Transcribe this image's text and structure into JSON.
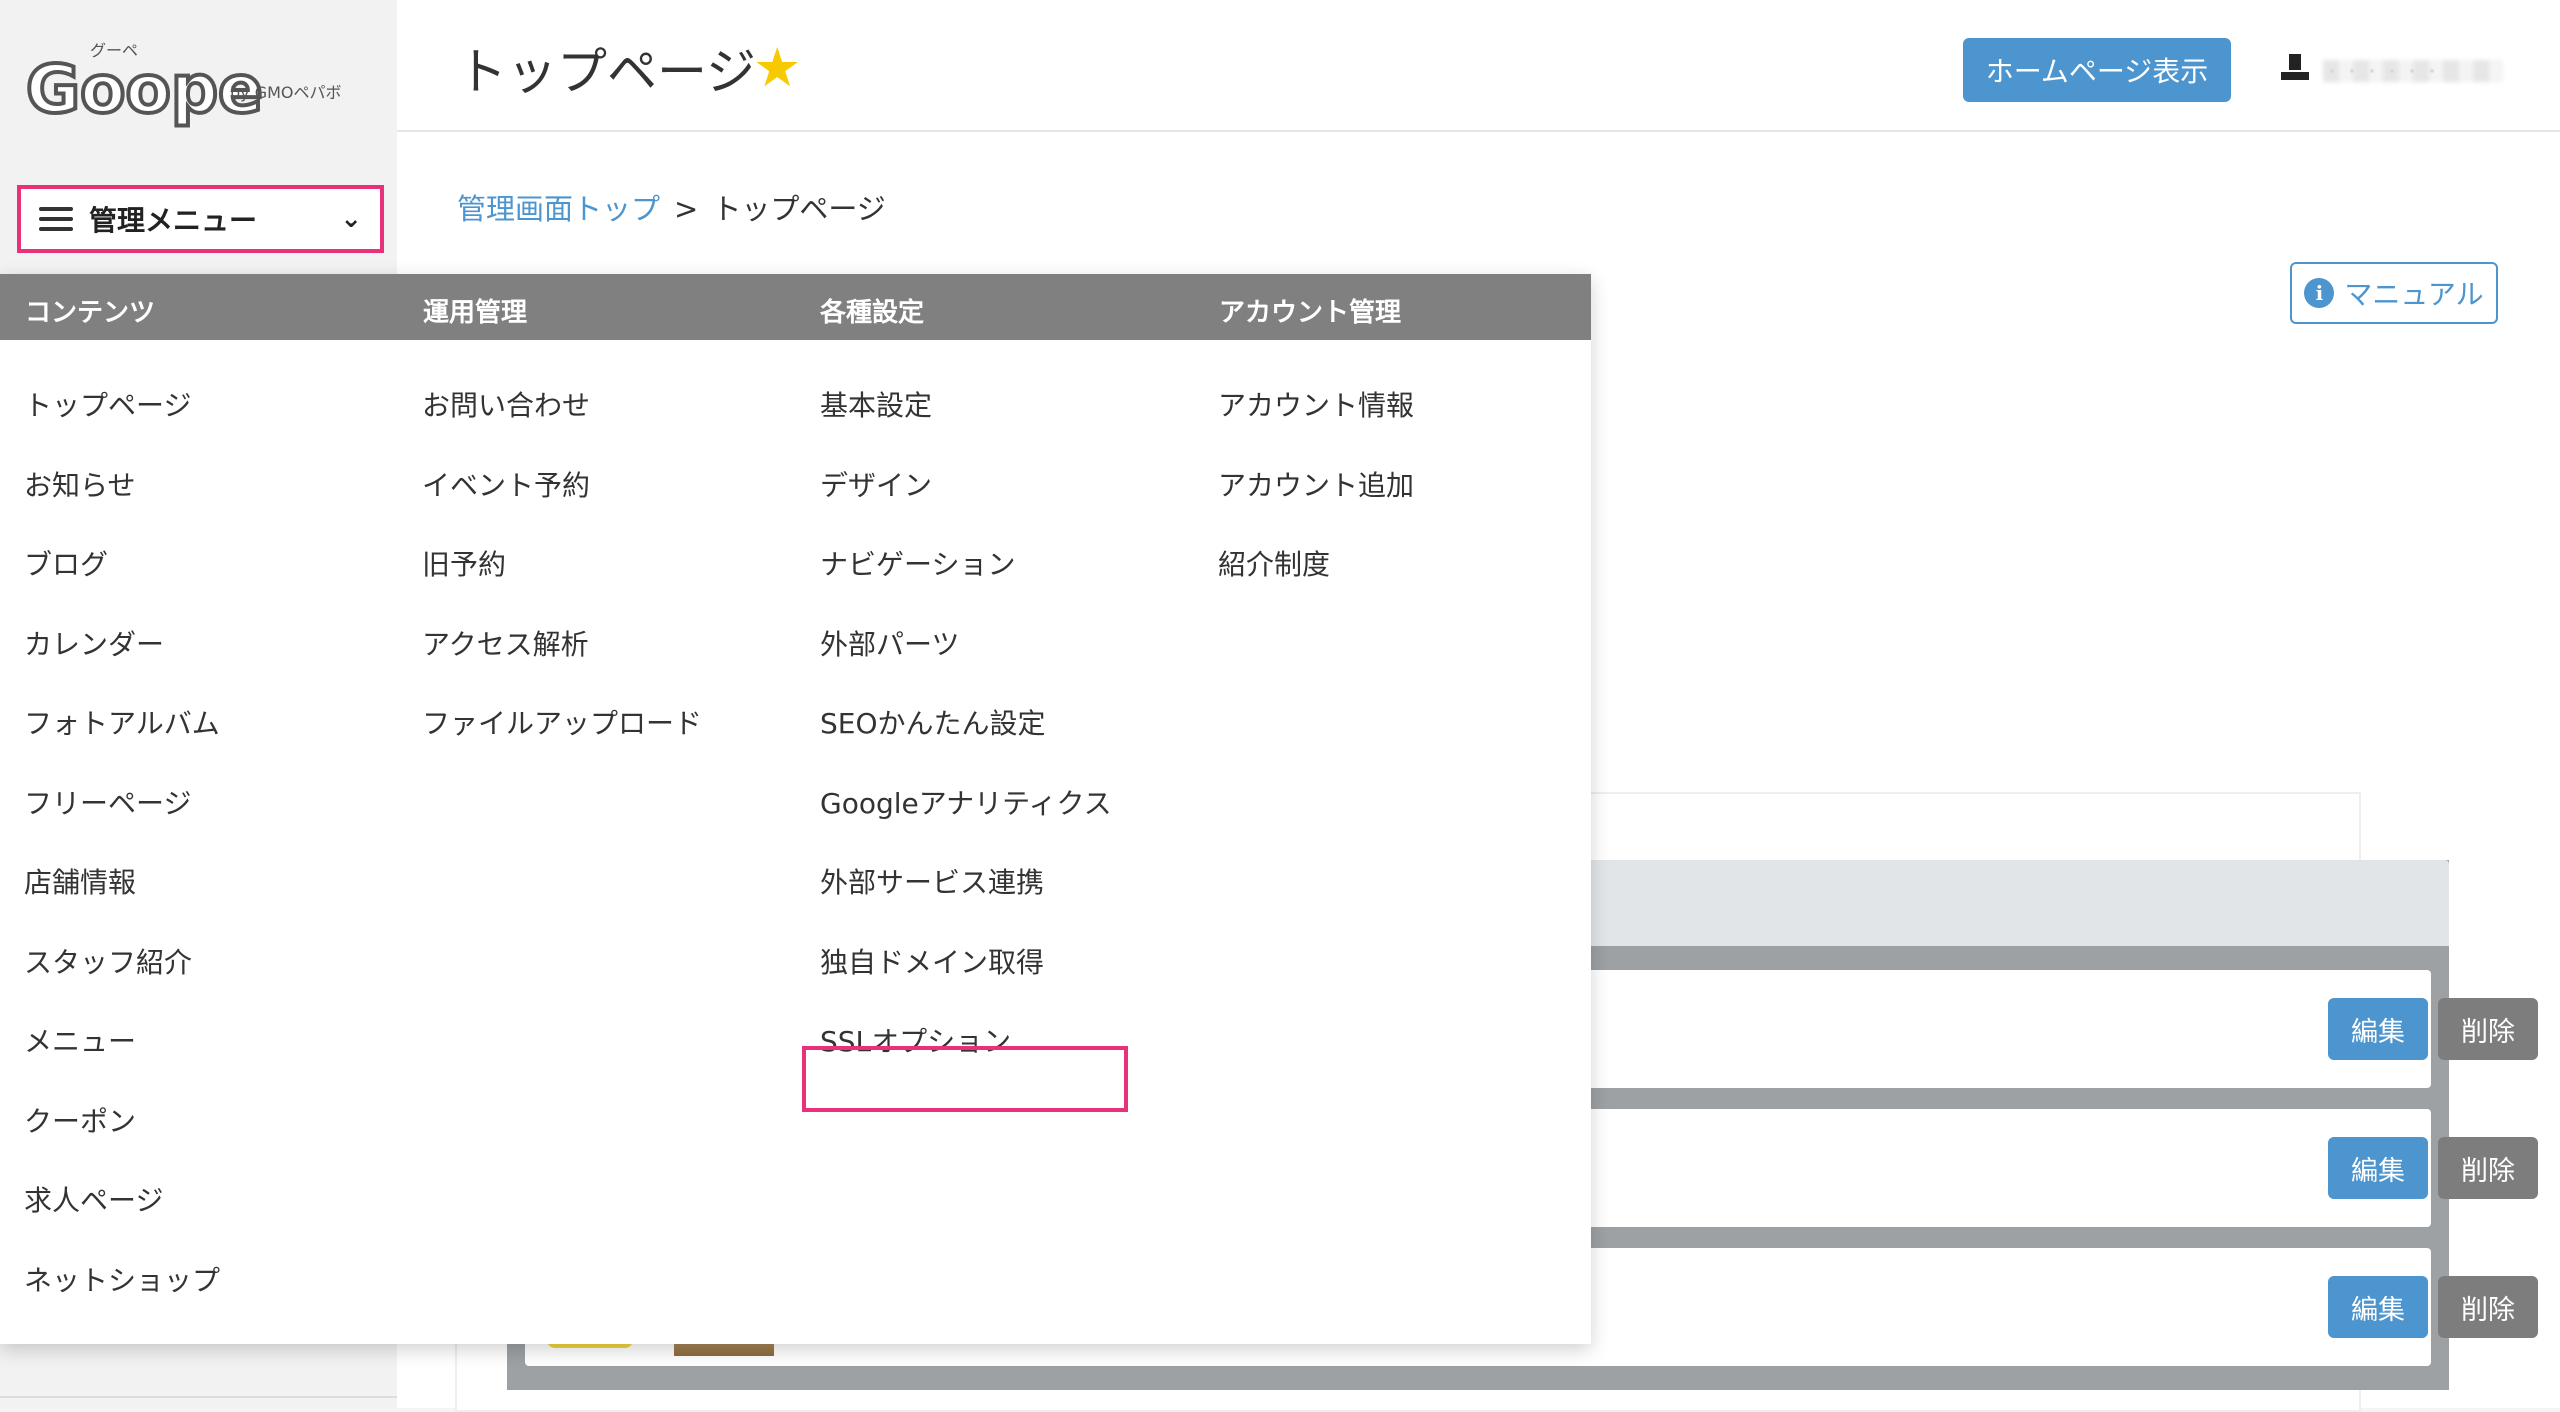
{
  "brand": {
    "logo_ruby": "グーペ",
    "logo_text": "Goope",
    "logo_by": "by GMOペパボ"
  },
  "sidebar": {
    "menu_label": "管理メニュー"
  },
  "header": {
    "title": "トップページ",
    "homepage_button": "ホームページ表示",
    "user_name": "・・・・・・"
  },
  "breadcrumb": {
    "home": "管理画面トップ",
    "separator": ">",
    "current": "トップページ"
  },
  "manual_button": "マニュアル",
  "rows": [
    {
      "edit": "編集",
      "delete": "削除"
    },
    {
      "edit": "編集",
      "delete": "削除"
    },
    {
      "edit": "編集",
      "delete": "削除"
    }
  ],
  "menu": {
    "columns": [
      {
        "heading": "コンテンツ",
        "items": [
          "トップページ",
          "お知らせ",
          "ブログ",
          "カレンダー",
          "フォトアルバム",
          "フリーページ",
          "店舗情報",
          "スタッフ紹介",
          "メニュー",
          "クーポン",
          "求人ページ",
          "ネットショップ"
        ]
      },
      {
        "heading": "運用管理",
        "items": [
          "お問い合わせ",
          "イベント予約",
          "旧予約",
          "アクセス解析",
          "ファイルアップロード"
        ]
      },
      {
        "heading": "各種設定",
        "items": [
          "基本設定",
          "デザイン",
          "ナビゲーション",
          "外部パーツ",
          "SEOかんたん設定",
          "Googleアナリティクス",
          "外部サービス連携",
          "独自ドメイン取得",
          "SSLオプション"
        ]
      },
      {
        "heading": "アカウント管理",
        "items": [
          "アカウント情報",
          "アカウント追加",
          "紹介制度"
        ]
      }
    ]
  },
  "colors": {
    "accent": "#4d95cf",
    "highlight": "#e8317a",
    "menu_header": "#808080",
    "star": "#f6c900"
  }
}
